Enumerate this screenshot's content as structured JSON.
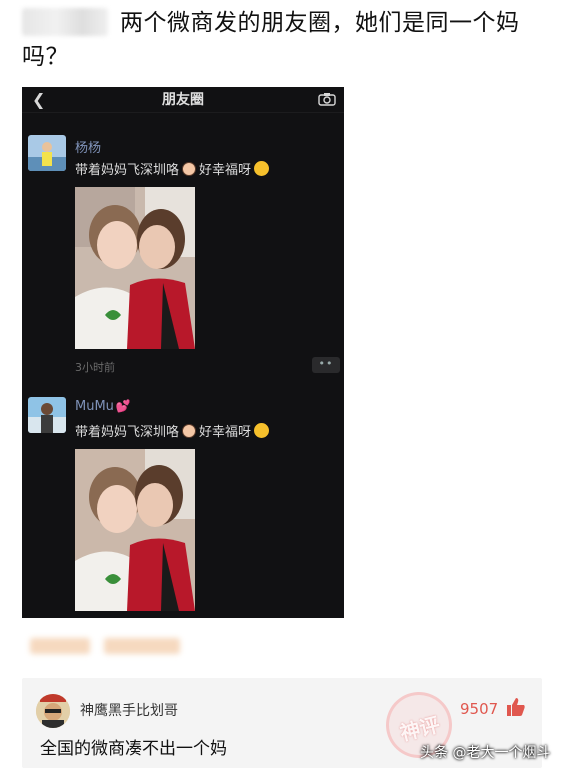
{
  "post": {
    "title": "两个微商发的朋友圈，她们是同一个妈吗？"
  },
  "screenshot": {
    "topbar": {
      "title": "朋友圈",
      "back_icon": "back-chevron-icon",
      "camera_icon": "camera-icon"
    },
    "moments": [
      {
        "name": "杨杨",
        "text_before": "带着妈妈飞深圳咯",
        "text_after": "好幸福呀",
        "time": "3小时前",
        "more": "••"
      },
      {
        "name": "MuMu",
        "name_heart": "💕",
        "text_before": "带着妈妈飞深圳咯",
        "text_after": "好幸福呀"
      }
    ]
  },
  "comment": {
    "user": "神鹰黑手比划哥",
    "text": "全国的微商凑不出一个妈",
    "likes": "9507",
    "like_icon": "thumbs-up-icon"
  },
  "stamp": {
    "text": "神评"
  },
  "watermark": "头条 @老大一个烟斗",
  "colors": {
    "like": "#e0574e",
    "name_link": "#7f92b8",
    "dark_bg": "#111113"
  }
}
